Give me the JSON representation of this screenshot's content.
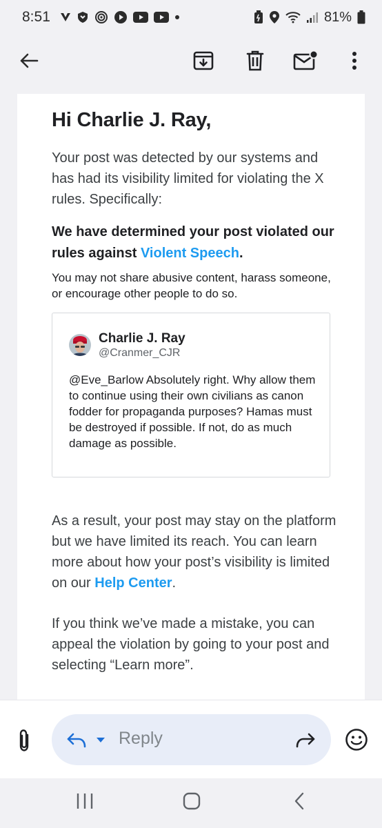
{
  "status_bar": {
    "time": "8:51",
    "battery_percent": "81%",
    "left_icons": [
      "v-icon",
      "shield-icon",
      "podcast-icon",
      "play-icon",
      "youtube-icon",
      "youtube-icon",
      "dot-icon"
    ],
    "right_icons": [
      "battery-saver-icon",
      "location-icon",
      "wifi-icon",
      "signal-icon",
      "battery-icon"
    ]
  },
  "app_bar": {
    "icons": [
      "back-arrow-icon",
      "archive-icon",
      "delete-icon",
      "mark-unread-icon",
      "more-vert-icon"
    ]
  },
  "email": {
    "greeting": "Hi Charlie J. Ray,",
    "intro": "Your post was detected by our systems and has had its visibility limited for violating the X rules. Specifically:",
    "determination_prefix": "We have determined your post violated our rules against ",
    "determination_link": "Violent Speech",
    "determination_suffix": ".",
    "policy_text": "You may not share abusive content, harass someone, or encourage other people to do so.",
    "tweet": {
      "name": "Charlie J. Ray",
      "handle": "@Cranmer_CJR",
      "body": "@Eve_Barlow Absolutely right. Why allow them to continue using their own civilians as canon fodder for propaganda purposes? Hamas must be destroyed if possible. If not, do as much damage as possible."
    },
    "result_prefix": "As a result, your post may stay on the platform but we have limited its reach. You can learn more about how your post’s visibility is limited on our ",
    "result_link": "Help Center",
    "result_suffix": ".",
    "appeal": "If you think we’ve made a mistake, you can appeal the violation by going to your post and selecting “Learn more”."
  },
  "reply_bar": {
    "placeholder": "Reply",
    "accent_color": "#1d6fd6"
  },
  "nav_bar": {
    "icons": [
      "recents-icon",
      "home-icon",
      "back-icon"
    ]
  },
  "colors": {
    "link": "#1d9bf0",
    "chrome_background": "#f1f1f4",
    "reply_pill": "#e8edf8"
  }
}
